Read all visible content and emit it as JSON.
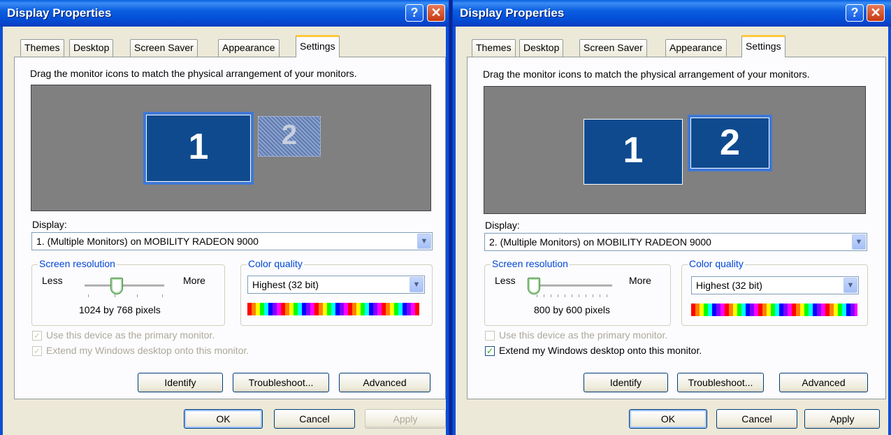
{
  "windows": [
    {
      "title": "Display Properties",
      "help_label": "?",
      "close_label": "✕",
      "tabs": [
        "Themes",
        "Desktop",
        "Screen Saver",
        "Appearance",
        "Settings"
      ],
      "active_tab": "Settings",
      "instruction": "Drag the monitor icons to match the physical arrangement of your monitors.",
      "monitors": [
        {
          "label": "1",
          "selected": true
        },
        {
          "label": "2",
          "selected": false,
          "inactive": true
        }
      ],
      "display_label": "Display:",
      "display_value": "1. (Multiple Monitors) on MOBILITY RADEON 9000",
      "resolution": {
        "group_label": "Screen resolution",
        "less": "Less",
        "more": "More",
        "value_text": "1024 by 768 pixels",
        "slider_position": 0.4
      },
      "color_quality": {
        "group_label": "Color quality",
        "value": "Highest (32 bit)"
      },
      "checkboxes": [
        {
          "label": "Use this device as the primary monitor.",
          "checked": true,
          "disabled": true
        },
        {
          "label": "Extend my Windows desktop onto this monitor.",
          "checked": true,
          "disabled": true
        }
      ],
      "buttons": {
        "identify": "Identify",
        "troubleshoot": "Troubleshoot...",
        "advanced": "Advanced"
      },
      "footer": {
        "ok": "OK",
        "cancel": "Cancel",
        "apply": "Apply",
        "apply_disabled": true
      }
    },
    {
      "title": "Display Properties",
      "help_label": "?",
      "close_label": "✕",
      "tabs": [
        "Themes",
        "Desktop",
        "Screen Saver",
        "Appearance",
        "Settings"
      ],
      "active_tab": "Settings",
      "instruction": "Drag the monitor icons to match the physical arrangement of your monitors.",
      "monitors": [
        {
          "label": "1",
          "selected": false
        },
        {
          "label": "2",
          "selected": true
        }
      ],
      "display_label": "Display:",
      "display_value": "2. (Multiple Monitors) on MOBILITY RADEON 9000",
      "resolution": {
        "group_label": "Screen resolution",
        "less": "Less",
        "more": "More",
        "value_text": "800 by 600 pixels",
        "slider_position": 0.0
      },
      "color_quality": {
        "group_label": "Color quality",
        "value": "Highest (32 bit)"
      },
      "checkboxes": [
        {
          "label": "Use this device as the primary monitor.",
          "checked": false,
          "disabled": true
        },
        {
          "label": "Extend my Windows desktop onto this monitor.",
          "checked": true,
          "disabled": false
        }
      ],
      "buttons": {
        "identify": "Identify",
        "troubleshoot": "Troubleshoot...",
        "advanced": "Advanced"
      },
      "footer": {
        "ok": "OK",
        "cancel": "Cancel",
        "apply": "Apply",
        "apply_disabled": false
      }
    }
  ]
}
